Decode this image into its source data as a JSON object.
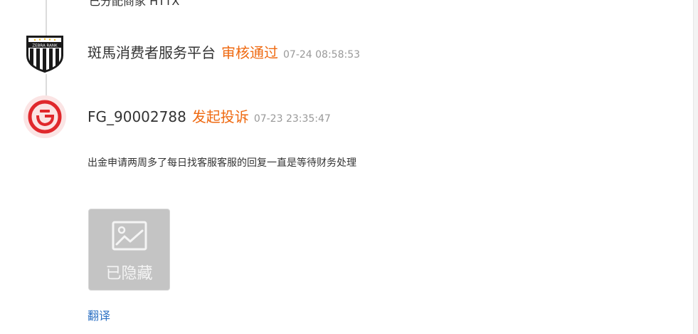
{
  "previous_entry": {
    "text": "已分配商家 HTTX"
  },
  "timeline": [
    {
      "author": "斑馬消费者服务平台",
      "action": "审核通过",
      "time": "07-24 08:58:53",
      "avatar_icon": "zebra-rank-shield-icon",
      "logo_text": "ZEBRA RANK"
    },
    {
      "author": "FG_90002788",
      "action": "发起投诉",
      "time": "07-23 23:35:47",
      "avatar_icon": "red-circle-logo-icon"
    }
  ],
  "complaint": {
    "message": "出金申请两周多了每日找客服客服的回复一直是等待财务处理",
    "image": {
      "label": "已隐藏",
      "icon": "image-placeholder-icon"
    },
    "translate_link": "翻译"
  },
  "colors": {
    "accent_orange": "#ef6a12",
    "link_blue": "#2f72c4",
    "time_gray": "#999999",
    "hidden_gray": "#c4c4c4"
  }
}
